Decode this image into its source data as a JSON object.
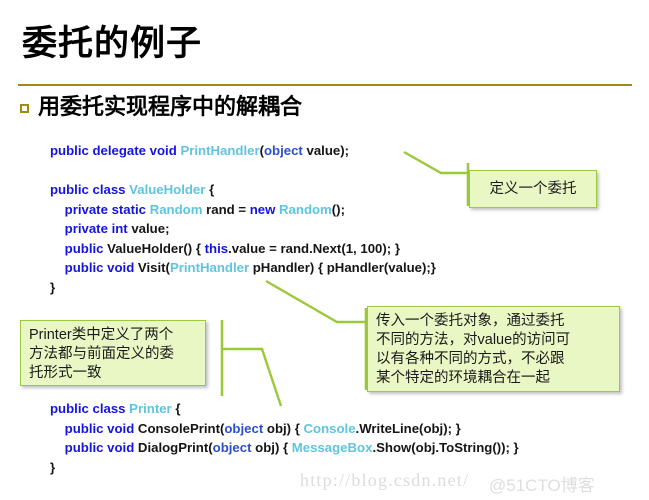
{
  "slide": {
    "title": "委托的例子",
    "bullet": {
      "marker": "square-outline-bullet-icon",
      "text": "用委托实现程序中的解耦合"
    }
  },
  "code_top": {
    "lines": [
      [
        {
          "t": "public delegate void ",
          "c": "kw"
        },
        {
          "t": "PrintHandler",
          "c": "typ"
        },
        {
          "t": "(",
          "c": "pln"
        },
        {
          "t": "object",
          "c": "obj"
        },
        {
          "t": " value);",
          "c": "pln"
        }
      ],
      [
        {
          "t": "",
          "c": "pln"
        }
      ],
      [
        {
          "t": "public class ",
          "c": "kw"
        },
        {
          "t": "ValueHolder",
          "c": "typ"
        },
        {
          "t": " {",
          "c": "pln"
        }
      ],
      [
        {
          "t": "    private static ",
          "c": "kw"
        },
        {
          "t": "Random",
          "c": "typ"
        },
        {
          "t": " rand = ",
          "c": "pln"
        },
        {
          "t": "new ",
          "c": "kw"
        },
        {
          "t": "Random",
          "c": "typ"
        },
        {
          "t": "();",
          "c": "pln"
        }
      ],
      [
        {
          "t": "    private int ",
          "c": "kw"
        },
        {
          "t": "value;",
          "c": "pln"
        }
      ],
      [
        {
          "t": "    public ",
          "c": "kw"
        },
        {
          "t": "ValueHolder() { ",
          "c": "pln"
        },
        {
          "t": "this",
          "c": "kw"
        },
        {
          "t": ".value = rand.Next(1, 100); }",
          "c": "pln"
        }
      ],
      [
        {
          "t": "    public void ",
          "c": "kw"
        },
        {
          "t": "Visit(",
          "c": "pln"
        },
        {
          "t": "PrintHandler",
          "c": "typ"
        },
        {
          "t": " pHandler) { pHandler(value);}",
          "c": "pln"
        }
      ],
      [
        {
          "t": "}",
          "c": "pln"
        }
      ]
    ]
  },
  "code_bottom": {
    "lines": [
      [
        {
          "t": "public class ",
          "c": "kw"
        },
        {
          "t": "Printer",
          "c": "typ"
        },
        {
          "t": " {",
          "c": "pln"
        }
      ],
      [
        {
          "t": "    public void ",
          "c": "kw"
        },
        {
          "t": "ConsolePrint(",
          "c": "pln"
        },
        {
          "t": "object",
          "c": "obj"
        },
        {
          "t": " obj) { ",
          "c": "pln"
        },
        {
          "t": "Console",
          "c": "typ"
        },
        {
          "t": ".WriteLine(obj); }",
          "c": "pln"
        }
      ],
      [
        {
          "t": "    public void ",
          "c": "kw"
        },
        {
          "t": "DialogPrint(",
          "c": "pln"
        },
        {
          "t": "object",
          "c": "obj"
        },
        {
          "t": " obj) { ",
          "c": "pln"
        },
        {
          "t": "MessageBox",
          "c": "typ"
        },
        {
          "t": ".Show(obj.ToString()); }",
          "c": "pln"
        }
      ],
      [
        {
          "t": "}",
          "c": "pln"
        }
      ]
    ]
  },
  "callouts": {
    "define_delegate": {
      "lines": [
        "定义一个委托"
      ]
    },
    "printer_note": {
      "lines": [
        "Printer类中定义了两个",
        "方法都与前面定义的委",
        "托形式一致"
      ]
    },
    "pass_delegate_note": {
      "lines": [
        "传入一个委托对象，通过委托",
        "不同的方法，对value的访问可",
        "以有各种不同的方式，不必跟",
        "某个特定的环境耦合在一起"
      ]
    }
  },
  "watermarks": {
    "url": "http://blog.csdn.net/",
    "blog": "@51CTO博客"
  },
  "colors": {
    "title_rule": "#9E8B13",
    "bullet_marker": "#9E8B13",
    "callout_fill": "#E9F7C4",
    "callout_border": "#9BC93A",
    "connector_line": "#9BC93A",
    "code_keyword": "#1414E0",
    "code_type": "#5FC4DE",
    "code_plain": "#151515",
    "background": "#FFFFFF"
  }
}
